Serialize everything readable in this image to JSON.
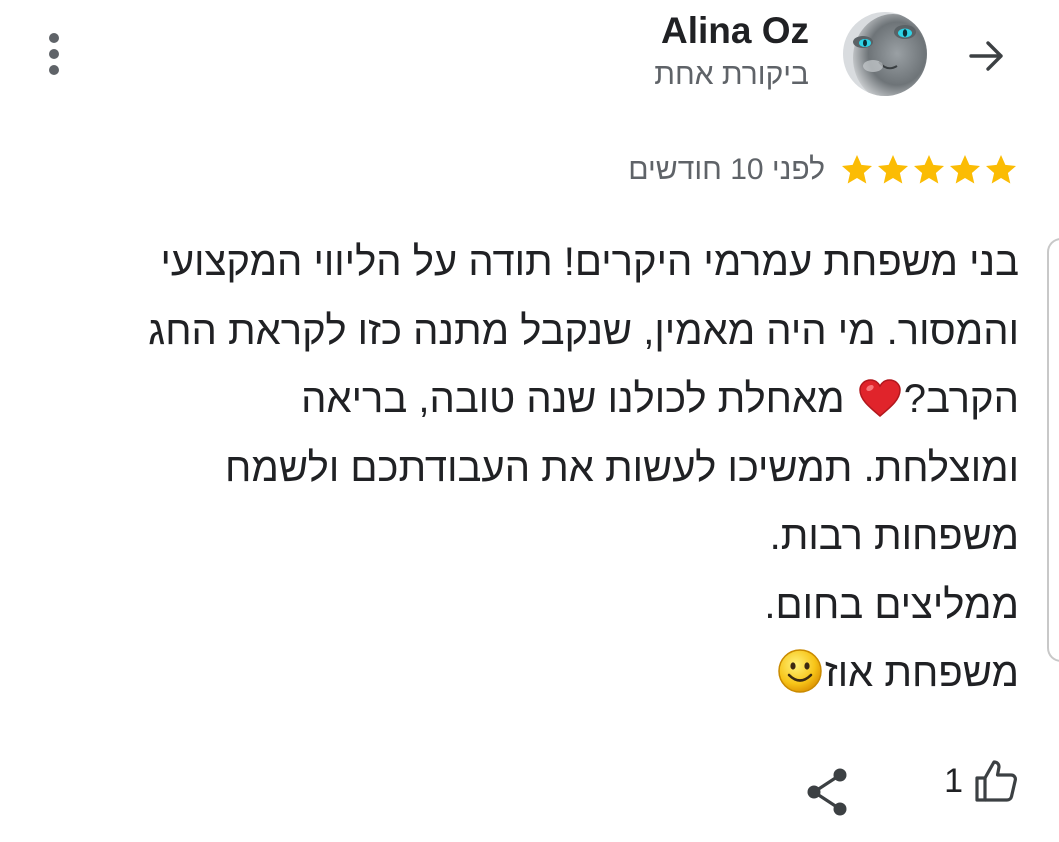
{
  "header": {
    "back_icon": "arrow-back-icon",
    "author_name": "Alina Oz",
    "review_count": "ביקורת אחת",
    "menu_icon": "more-vert-icon"
  },
  "review": {
    "rating": 5,
    "rating_max": 5,
    "star_color": "#fbbc04",
    "time_ago": "לפני 10 חודשים",
    "lines": [
      "בני משפחת עמרמי היקרים! תודה על הליווי המקצועי",
      "והמסור. מי היה מאמין, שנקבל מתנה כזו לקראת החג",
      "הקרב?",
      "ומוצלחת. תמשיכו לעשות את העבודתכם ולשמח",
      "משפחות רבות.",
      "ממליצים בחום.",
      "משפחת אוז"
    ],
    "line3_after_heart": " מאחלת לכולנו שנה טובה, בריאה"
  },
  "actions": {
    "like_icon": "thumb-up-icon",
    "like_count": "1",
    "share_icon": "share-icon"
  }
}
